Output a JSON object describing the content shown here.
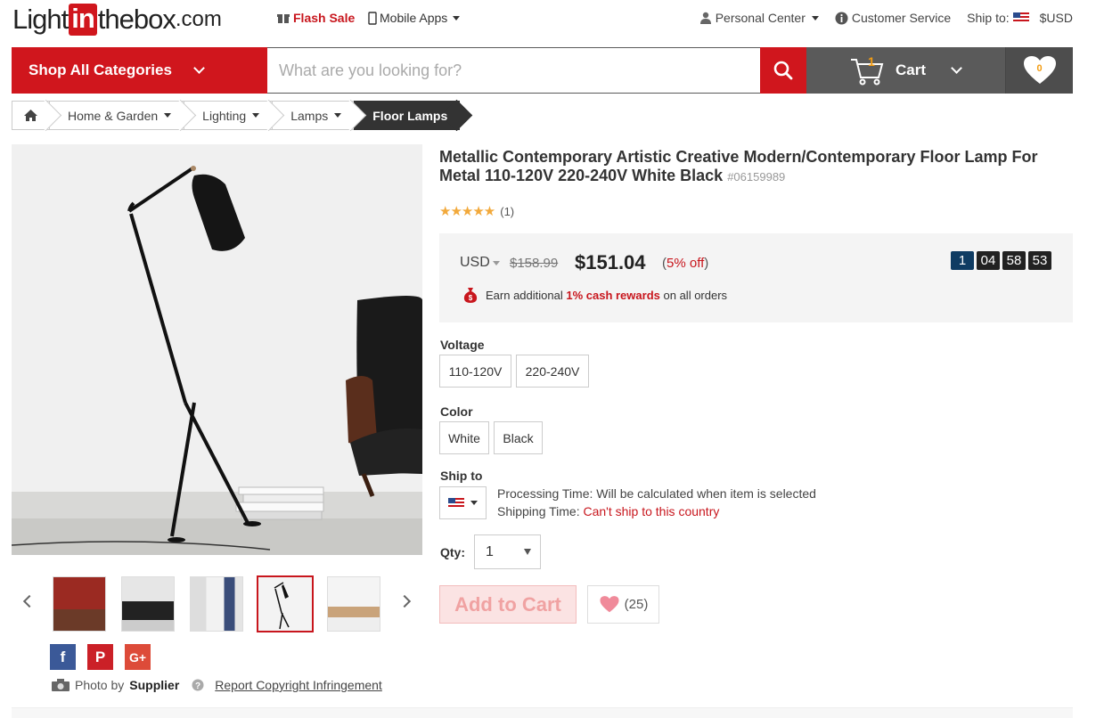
{
  "header": {
    "logo_pre": "Light",
    "logo_in": "in",
    "logo_post": "thebox",
    "logo_com": ".com",
    "flash_sale": "Flash Sale",
    "mobile_apps": "Mobile Apps",
    "personal_center": "Personal Center",
    "customer_service": "Customer Service",
    "ship_to": "Ship to:",
    "currency": "$USD"
  },
  "nav": {
    "shop_all": "Shop All Categories",
    "search_placeholder": "What are you looking for?",
    "cart_label": "Cart",
    "cart_count": "1",
    "wish_count": "0"
  },
  "breadcrumb": {
    "items": [
      "Home & Garden",
      "Lighting",
      "Lamps"
    ],
    "current": "Floor Lamps"
  },
  "product": {
    "title": "Metallic Contemporary Artistic Creative Modern/Contemporary Floor Lamp For Metal 110-120V 220-240V White Black",
    "sku": "#06159989",
    "review_count": "(1)",
    "currency": "USD",
    "old_price": "$158.99",
    "price": "$151.04",
    "discount_open": "(",
    "discount": "5% off",
    "discount_close": ")",
    "cash_prefix": "Earn additional",
    "cash_highlight": "1% cash rewards",
    "cash_suffix": "on all orders",
    "timer": {
      "days": "1",
      "hours": "04",
      "minutes": "58",
      "seconds": "53"
    }
  },
  "options": {
    "voltage_label": "Voltage",
    "voltages": [
      "110-120V",
      "220-240V"
    ],
    "color_label": "Color",
    "colors": [
      "White",
      "Black"
    ],
    "ship_label": "Ship to",
    "processing": "Processing Time: Will be calculated when item is selected",
    "shipping_prefix": "Shipping Time:",
    "shipping_value": "Can't ship to this country",
    "qty_label": "Qty:",
    "qty_value": "1",
    "add_to_cart": "Add to Cart",
    "wish_count": "(25)"
  },
  "gallery": {
    "photo_by": "Photo by",
    "supplier": "Supplier",
    "report": "Report Copyright Infringement"
  },
  "colors": {
    "brand_red": "#d0161d",
    "nav_gray": "#5a5a5a"
  }
}
